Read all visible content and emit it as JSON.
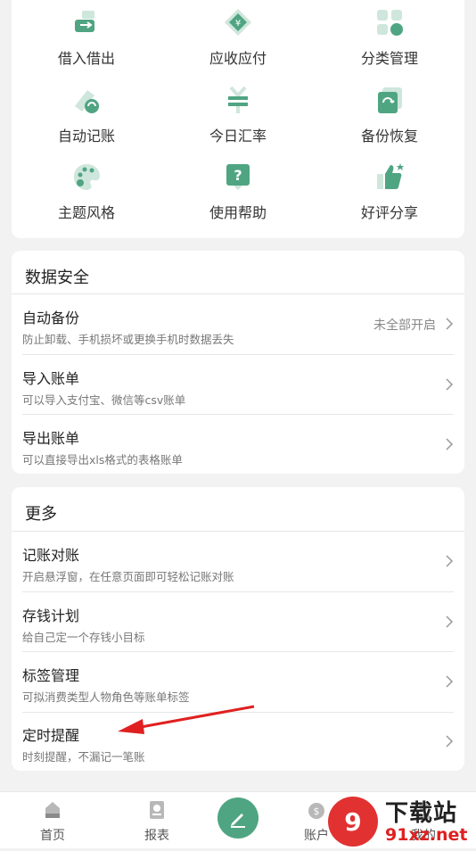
{
  "grid": [
    {
      "label": "借入借出",
      "icon": "lend-borrow-icon"
    },
    {
      "label": "应收应付",
      "icon": "receivable-payable-icon"
    },
    {
      "label": "分类管理",
      "icon": "category-icon"
    },
    {
      "label": "自动记账",
      "icon": "auto-bookkeeping-icon"
    },
    {
      "label": "今日汇率",
      "icon": "exchange-rate-icon"
    },
    {
      "label": "备份恢复",
      "icon": "backup-restore-icon"
    },
    {
      "label": "主题风格",
      "icon": "palette-icon"
    },
    {
      "label": "使用帮助",
      "icon": "help-icon"
    },
    {
      "label": "好评分享",
      "icon": "thumbs-up-icon"
    }
  ],
  "data_security": {
    "title": "数据安全",
    "rows": [
      {
        "title": "自动备份",
        "subtitle": "防止卸载、手机损坏或更换手机时数据丢失",
        "value": "未全部开启"
      },
      {
        "title": "导入账单",
        "subtitle": "可以导入支付宝、微信等csv账单",
        "value": ""
      },
      {
        "title": "导出账单",
        "subtitle": "可以直接导出xls格式的表格账单",
        "value": ""
      }
    ]
  },
  "more": {
    "title": "更多",
    "rows": [
      {
        "title": "记账对账",
        "subtitle": "开启悬浮窗，在任意页面即可轻松记账对账"
      },
      {
        "title": "存钱计划",
        "subtitle": "给自己定一个存钱小目标"
      },
      {
        "title": "标签管理",
        "subtitle": "可拟消费类型人物角色等账单标签"
      },
      {
        "title": "定时提醒",
        "subtitle": "时刻提醒，不漏记一笔账"
      }
    ]
  },
  "tabbar": {
    "home": "首页",
    "report": "报表",
    "account": "账户",
    "mine": "我的"
  },
  "watermark": {
    "brand": "下载站",
    "domain": "91xz.net"
  },
  "colors": {
    "accent": "#4fa582",
    "icon_light": "#cfe6dc",
    "annotation": "#e02020"
  }
}
